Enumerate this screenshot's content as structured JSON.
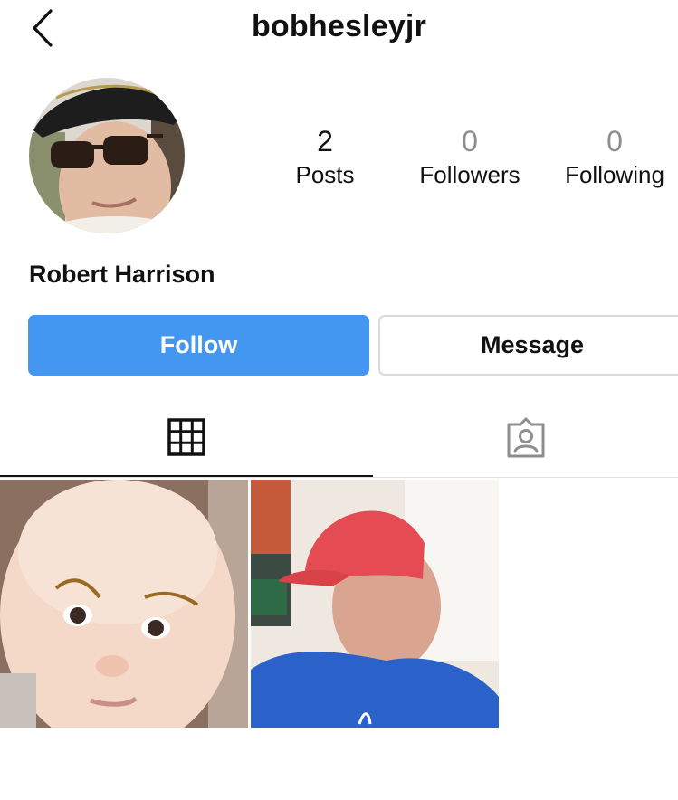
{
  "header": {
    "username": "bobhesleyjr",
    "back_icon": "chevron-left-icon"
  },
  "profile": {
    "full_name": "Robert Harrison",
    "avatar": "avatar-photo"
  },
  "stats": [
    {
      "count": "2",
      "label": "Posts"
    },
    {
      "count": "0",
      "label": "Followers"
    },
    {
      "count": "0",
      "label": "Following"
    }
  ],
  "actions": {
    "follow_label": "Follow",
    "message_label": "Message"
  },
  "tabs": [
    {
      "icon": "grid-icon",
      "selected": true
    },
    {
      "icon": "tagged-person-icon",
      "selected": false
    }
  ],
  "posts": [
    {
      "thumbnail": "baby-photo"
    },
    {
      "thumbnail": "man-red-cap-photo"
    }
  ],
  "colors": {
    "follow_button": "#4497f1",
    "muted_text": "#8e8e8e",
    "border": "#dbdbdb"
  }
}
